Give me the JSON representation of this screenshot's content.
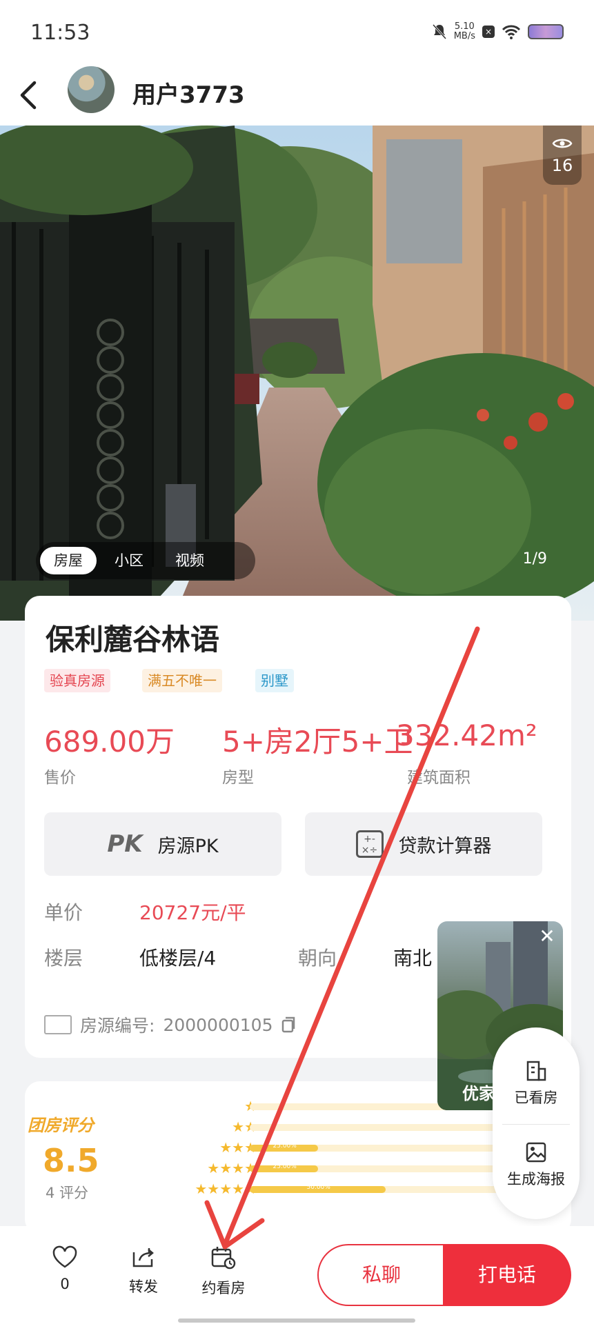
{
  "status_bar": {
    "time": "11:53",
    "net_speed": "5.10",
    "net_unit": "MB/s"
  },
  "header": {
    "user_name": "用户3773"
  },
  "gallery": {
    "view_count": "16",
    "tabs": [
      "房屋",
      "小区",
      "视频"
    ],
    "counter": "1/9"
  },
  "listing": {
    "title": "保利麓谷林语",
    "tags": [
      "验真房源",
      "满五不唯一",
      "别墅"
    ],
    "price_value": "689.00万",
    "price_label": "售价",
    "layout_value": "5+房2厅5+卫",
    "layout_label": "房型",
    "area_value": "332.42m²",
    "area_label": "建筑面积",
    "pk_button": "房源PK",
    "pk_mark": "PK",
    "loan_button": "贷款计算器",
    "unit_price_label": "单价",
    "unit_price_value": "20727元/平",
    "floor_label": "楼层",
    "floor_value": "低楼层/4",
    "orientation_label": "朝向",
    "orientation_value": "南北",
    "listing_id_label": "房源编号:",
    "listing_id_value": "2000000105"
  },
  "rating": {
    "title": "团房评分",
    "score": "8.5",
    "count": "4 评分",
    "distribution": [
      {
        "stars": 1,
        "fraction": 0.0,
        "label": ""
      },
      {
        "stars": 2,
        "fraction": 0.0,
        "label": ""
      },
      {
        "stars": 3,
        "fraction": 0.25,
        "label": "25.00%"
      },
      {
        "stars": 4,
        "fraction": 0.25,
        "label": "25.00%"
      },
      {
        "stars": 5,
        "fraction": 0.5,
        "label": "50.00%"
      }
    ]
  },
  "video_widget": {
    "caption": "优家"
  },
  "side_panel": {
    "viewed": "已看房",
    "poster": "生成海报"
  },
  "bottom_bar": {
    "favorite_count": "0",
    "share": "转发",
    "schedule": "约看房",
    "chat": "私聊",
    "call": "打电话"
  },
  "colors": {
    "accent": "#ee2f3c",
    "price": "#e84a55",
    "rating": "#f0a92b"
  }
}
